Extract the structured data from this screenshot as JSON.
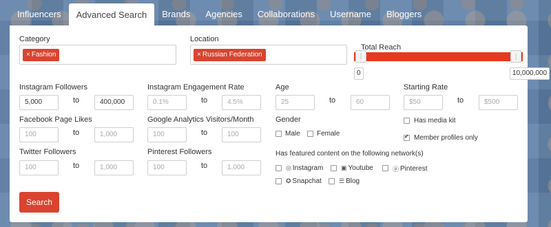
{
  "tabs": [
    "Influencers",
    "Advanced Search",
    "Brands",
    "Agencies",
    "Collaborations",
    "Username",
    "Bloggers"
  ],
  "category": {
    "label": "Category",
    "tag": "Fashion"
  },
  "location": {
    "label": "Location",
    "tag": "Russian Federation"
  },
  "reach": {
    "label": "Total Reach",
    "min": "0",
    "max": "10,000,000",
    "accent": "#e63a1e"
  },
  "to_label": "to",
  "fields": {
    "instagram_followers": {
      "label": "Instagram Followers",
      "from": "5,000",
      "to": "400,000"
    },
    "engagement": {
      "label": "Instagram Engagement Rate",
      "from_ph": "0.1%",
      "to_ph": "4.5%"
    },
    "age": {
      "label": "Age",
      "from_ph": "25",
      "to_ph": "60"
    },
    "starting_rate": {
      "label": "Starting Rate",
      "from_ph": "$50",
      "to_ph": "$500"
    },
    "facebook": {
      "label": "Facebook Page Likes",
      "from_ph": "100",
      "to_ph": "1,000"
    },
    "ga": {
      "label": "Google Analytics Visitors/Month",
      "from_ph": "100",
      "to_ph": "100"
    },
    "twitter": {
      "label": "Twitter Followers",
      "from_ph": "100",
      "to_ph": "1,000"
    },
    "pinterest": {
      "label": "Pinterest Followers",
      "from_ph": "100",
      "to_ph": "1,000"
    }
  },
  "gender": {
    "label": "Gender",
    "male": "Male",
    "female": "Female"
  },
  "options": {
    "media_kit": "Has media kit",
    "members_only": "Member profiles only"
  },
  "networks": {
    "label": "Has featured content on the following network(s)",
    "instagram": "Instagram",
    "youtube": "Youtube",
    "pinterest": "Pinterest",
    "snapchat": "Snapchat",
    "blog": "Blog"
  },
  "search_button": "Search",
  "brand_color": "#d9432f"
}
